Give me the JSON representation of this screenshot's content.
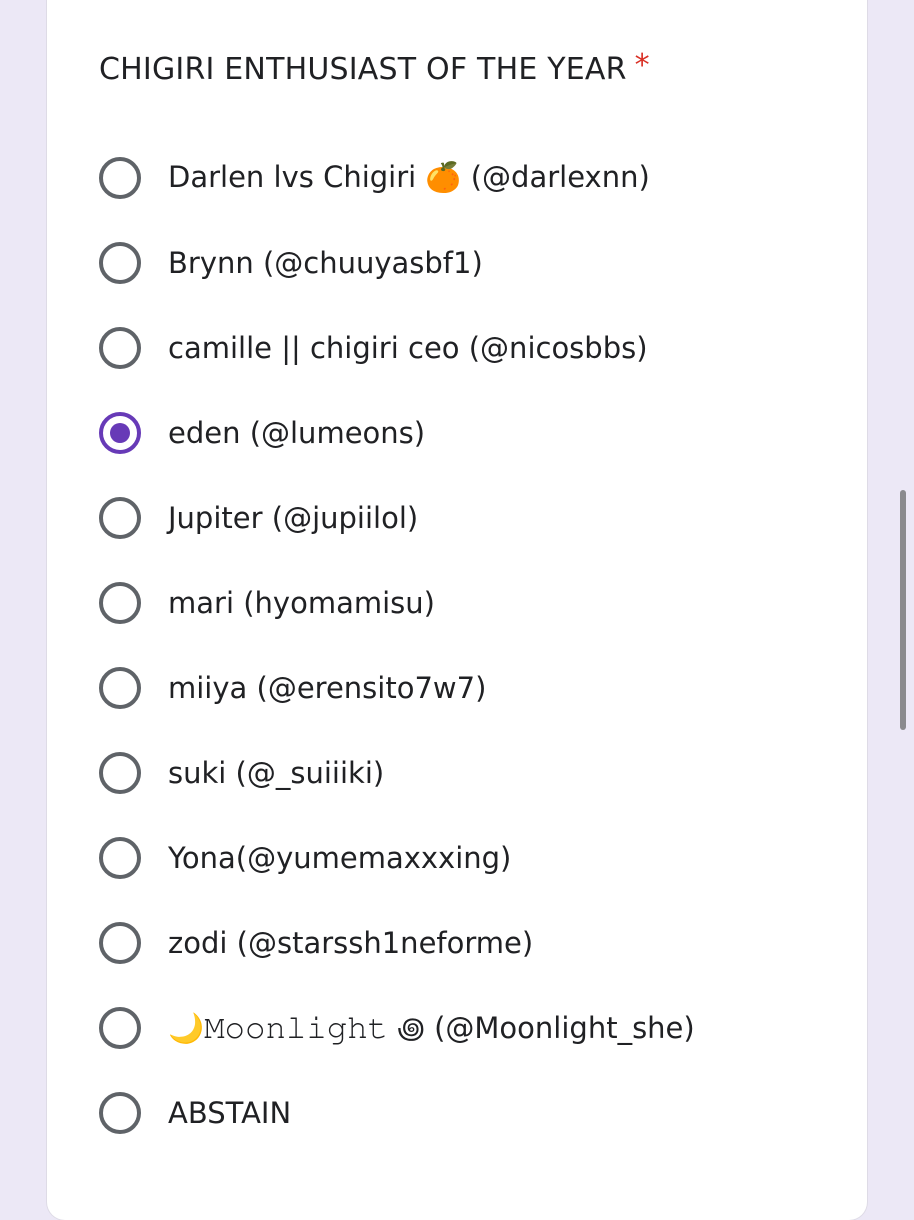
{
  "form": {
    "question_title": "CHIGIRI ENTHUSIAST OF THE YEAR",
    "required_marker": "*",
    "selected_index": 3,
    "options": [
      "Darlen lvs Chigiri 🍊 (@darlexnn)",
      "Brynn (@chuuyasbf1)",
      "camille || chigiri ceo (@nicosbbs)",
      "eden (@lumeons)",
      "Jupiter (@jupiilol)",
      "mari (hyomamisu)",
      "miiya (@erensito7w7)",
      "suki (@_suiiiki)",
      "Yona(@yumemaxxxing)",
      "zodi (@starssh1neforme)",
      "🌙𝙼𝚘𝚘𝚗𝚕𝚒𝚐𝚑𝚝 ꩜ (@Moonlight_she)",
      "ABSTAIN"
    ]
  },
  "colors": {
    "accent": "#673ab7",
    "required": "#d93025",
    "page_background": "#ece8f6"
  }
}
